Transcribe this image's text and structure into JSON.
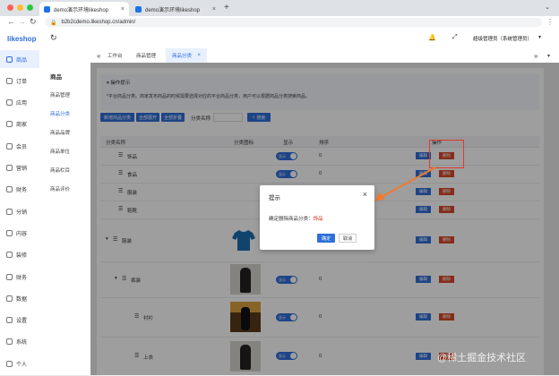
{
  "browser": {
    "tabs": [
      {
        "title": "demo演示环境likeshop"
      },
      {
        "title": "demo演示环境likeshop"
      }
    ],
    "new_tab": "+",
    "url": "b2b2cdemo.likeshop.cn/admin/"
  },
  "app": {
    "logo": "likeshop",
    "user": "超级管理员（系统管理员）"
  },
  "sidebar": [
    {
      "label": "商品"
    },
    {
      "label": "订单"
    },
    {
      "label": "应用"
    },
    {
      "label": "商家"
    },
    {
      "label": "会员"
    },
    {
      "label": "营销"
    },
    {
      "label": "财务"
    },
    {
      "label": "分销"
    },
    {
      "label": "内容"
    },
    {
      "label": "装修"
    },
    {
      "label": "财务"
    },
    {
      "label": "数据"
    },
    {
      "label": "设置"
    },
    {
      "label": "系统"
    },
    {
      "label": "个人"
    }
  ],
  "submenu": {
    "title": "商品",
    "items": [
      {
        "label": "商品管理"
      },
      {
        "label": "商品分类"
      },
      {
        "label": "商品品牌"
      },
      {
        "label": "商品单位"
      },
      {
        "label": "商品栏目"
      },
      {
        "label": "商品评价"
      }
    ]
  },
  "page_tabs": [
    {
      "label": "工作台"
    },
    {
      "label": "商品管理"
    },
    {
      "label": "商品分类"
    }
  ],
  "tip": {
    "title": "操作提示",
    "text": "*平台商品分类。商家发布商品的时候需要选择对应的平台商品分类，用户可以根据商品分类搜索商品。"
  },
  "toolbar": {
    "add": "新增商品分类",
    "expand": "全部展开",
    "collapse": "全部折叠",
    "search_label": "分类名称",
    "search_btn": "搜索"
  },
  "table": {
    "headers": [
      "分类名称",
      "分类图标",
      "显示",
      "排序",
      "操作"
    ],
    "rows": [
      {
        "name": "饰品",
        "toggle": "显示",
        "sort": "0"
      },
      {
        "name": "食品",
        "toggle": "显示",
        "sort": "0"
      },
      {
        "name": "服装",
        "toggle": "显示",
        "sort": "0"
      },
      {
        "name": "鞋靴",
        "toggle": "显示",
        "sort": "0"
      },
      {
        "name": "服装",
        "toggle": "显示",
        "sort": "0"
      },
      {
        "name": "裤装",
        "toggle": "显示",
        "sort": "0"
      },
      {
        "name": "衬衫",
        "toggle": "显示",
        "sort": "0"
      },
      {
        "name": "上衣",
        "toggle": "显示",
        "sort": "0"
      }
    ],
    "edit": "编辑",
    "delete": "删除"
  },
  "modal": {
    "title": "提示",
    "msg_prefix": "确定删除商品分类：",
    "msg_target": "饰品",
    "ok": "确定",
    "cancel": "取消"
  },
  "watermark": "@稀土掘金技术社区",
  "colors": {
    "accent": "#2f6fd8",
    "danger": "#d64a2b"
  }
}
